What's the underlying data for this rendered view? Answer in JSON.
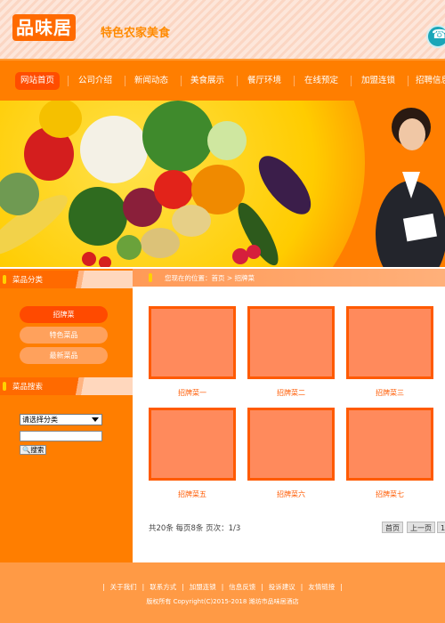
{
  "header": {
    "logo": "品味居",
    "slogan": "特色农家美食"
  },
  "nav": {
    "items": [
      {
        "label": "网站首页",
        "active": true
      },
      {
        "label": "公司介绍"
      },
      {
        "label": "新闻动态"
      },
      {
        "label": "美食展示"
      },
      {
        "label": "餐厅环境"
      },
      {
        "label": "在线预定"
      },
      {
        "label": "加盟连锁"
      },
      {
        "label": "招聘信息"
      }
    ]
  },
  "sidebar": {
    "category_title": "菜品分类",
    "categories": [
      "招牌菜",
      "特色菜品",
      "最新菜品"
    ],
    "search_title": "菜品搜索",
    "select_value": "请选择分类",
    "search_button": "搜索"
  },
  "main": {
    "breadcrumb": "您现在的位置：首页 > 招牌菜",
    "items": [
      "招牌菜一",
      "招牌菜二",
      "招牌菜三",
      "招牌菜五",
      "招牌菜六",
      "招牌菜七"
    ],
    "pager_info": "共20条  每页8条  页次：1/3",
    "pager_first": "首页",
    "pager_prev": "上一页",
    "pager_next": "1"
  },
  "footer": {
    "links": [
      "关于我们",
      "联系方式",
      "加盟连锁",
      "信息反馈",
      "投诉建议",
      "友情链接"
    ],
    "copyright": "版权所有 Copyright(C)2015-2018 潍坊市品味居酒店"
  },
  "colors": {
    "primary": "#ff7e00",
    "accent": "#ff4a00",
    "footer": "#ff9a45"
  }
}
